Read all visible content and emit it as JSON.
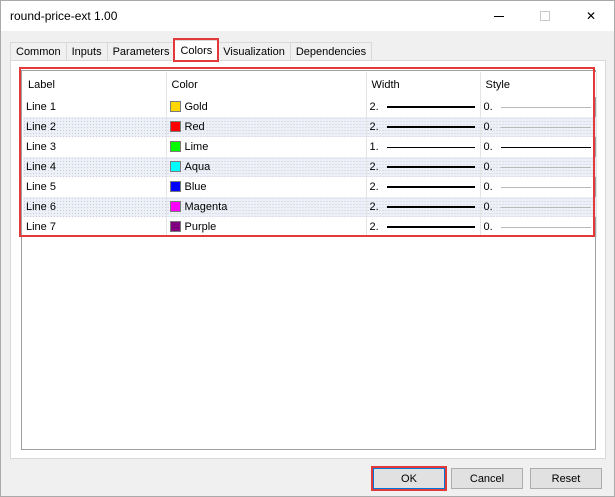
{
  "window": {
    "title": "round-price-ext 1.00",
    "close_glyph": "✕"
  },
  "tabs": [
    {
      "label": "Common"
    },
    {
      "label": "Inputs"
    },
    {
      "label": "Parameters"
    },
    {
      "label": "Colors"
    },
    {
      "label": "Visualization"
    },
    {
      "label": "Dependencies"
    }
  ],
  "active_tab": "Colors",
  "table": {
    "headers": {
      "label": "Label",
      "color": "Color",
      "width": "Width",
      "style": "Style"
    },
    "rows": [
      {
        "label": "Line 1",
        "color_name": "Gold",
        "color_hex": "#FFD700",
        "width": "2.",
        "style": "0."
      },
      {
        "label": "Line 2",
        "color_name": "Red",
        "color_hex": "#FF0000",
        "width": "2.",
        "style": "0."
      },
      {
        "label": "Line 3",
        "color_name": "Lime",
        "color_hex": "#00FF00",
        "width": "1.",
        "style": "0."
      },
      {
        "label": "Line 4",
        "color_name": "Aqua",
        "color_hex": "#00FFFF",
        "width": "2.",
        "style": "0."
      },
      {
        "label": "Line 5",
        "color_name": "Blue",
        "color_hex": "#0000FF",
        "width": "2.",
        "style": "0."
      },
      {
        "label": "Line 6",
        "color_name": "Magenta",
        "color_hex": "#FF00FF",
        "width": "2.",
        "style": "0."
      },
      {
        "label": "Line 7",
        "color_name": "Purple",
        "color_hex": "#800080",
        "width": "2.",
        "style": "0."
      }
    ]
  },
  "buttons": {
    "ok": "OK",
    "cancel": "Cancel",
    "reset": "Reset"
  },
  "colors": {
    "highlight": "#e23a3a",
    "focus_border": "#0078d7"
  }
}
